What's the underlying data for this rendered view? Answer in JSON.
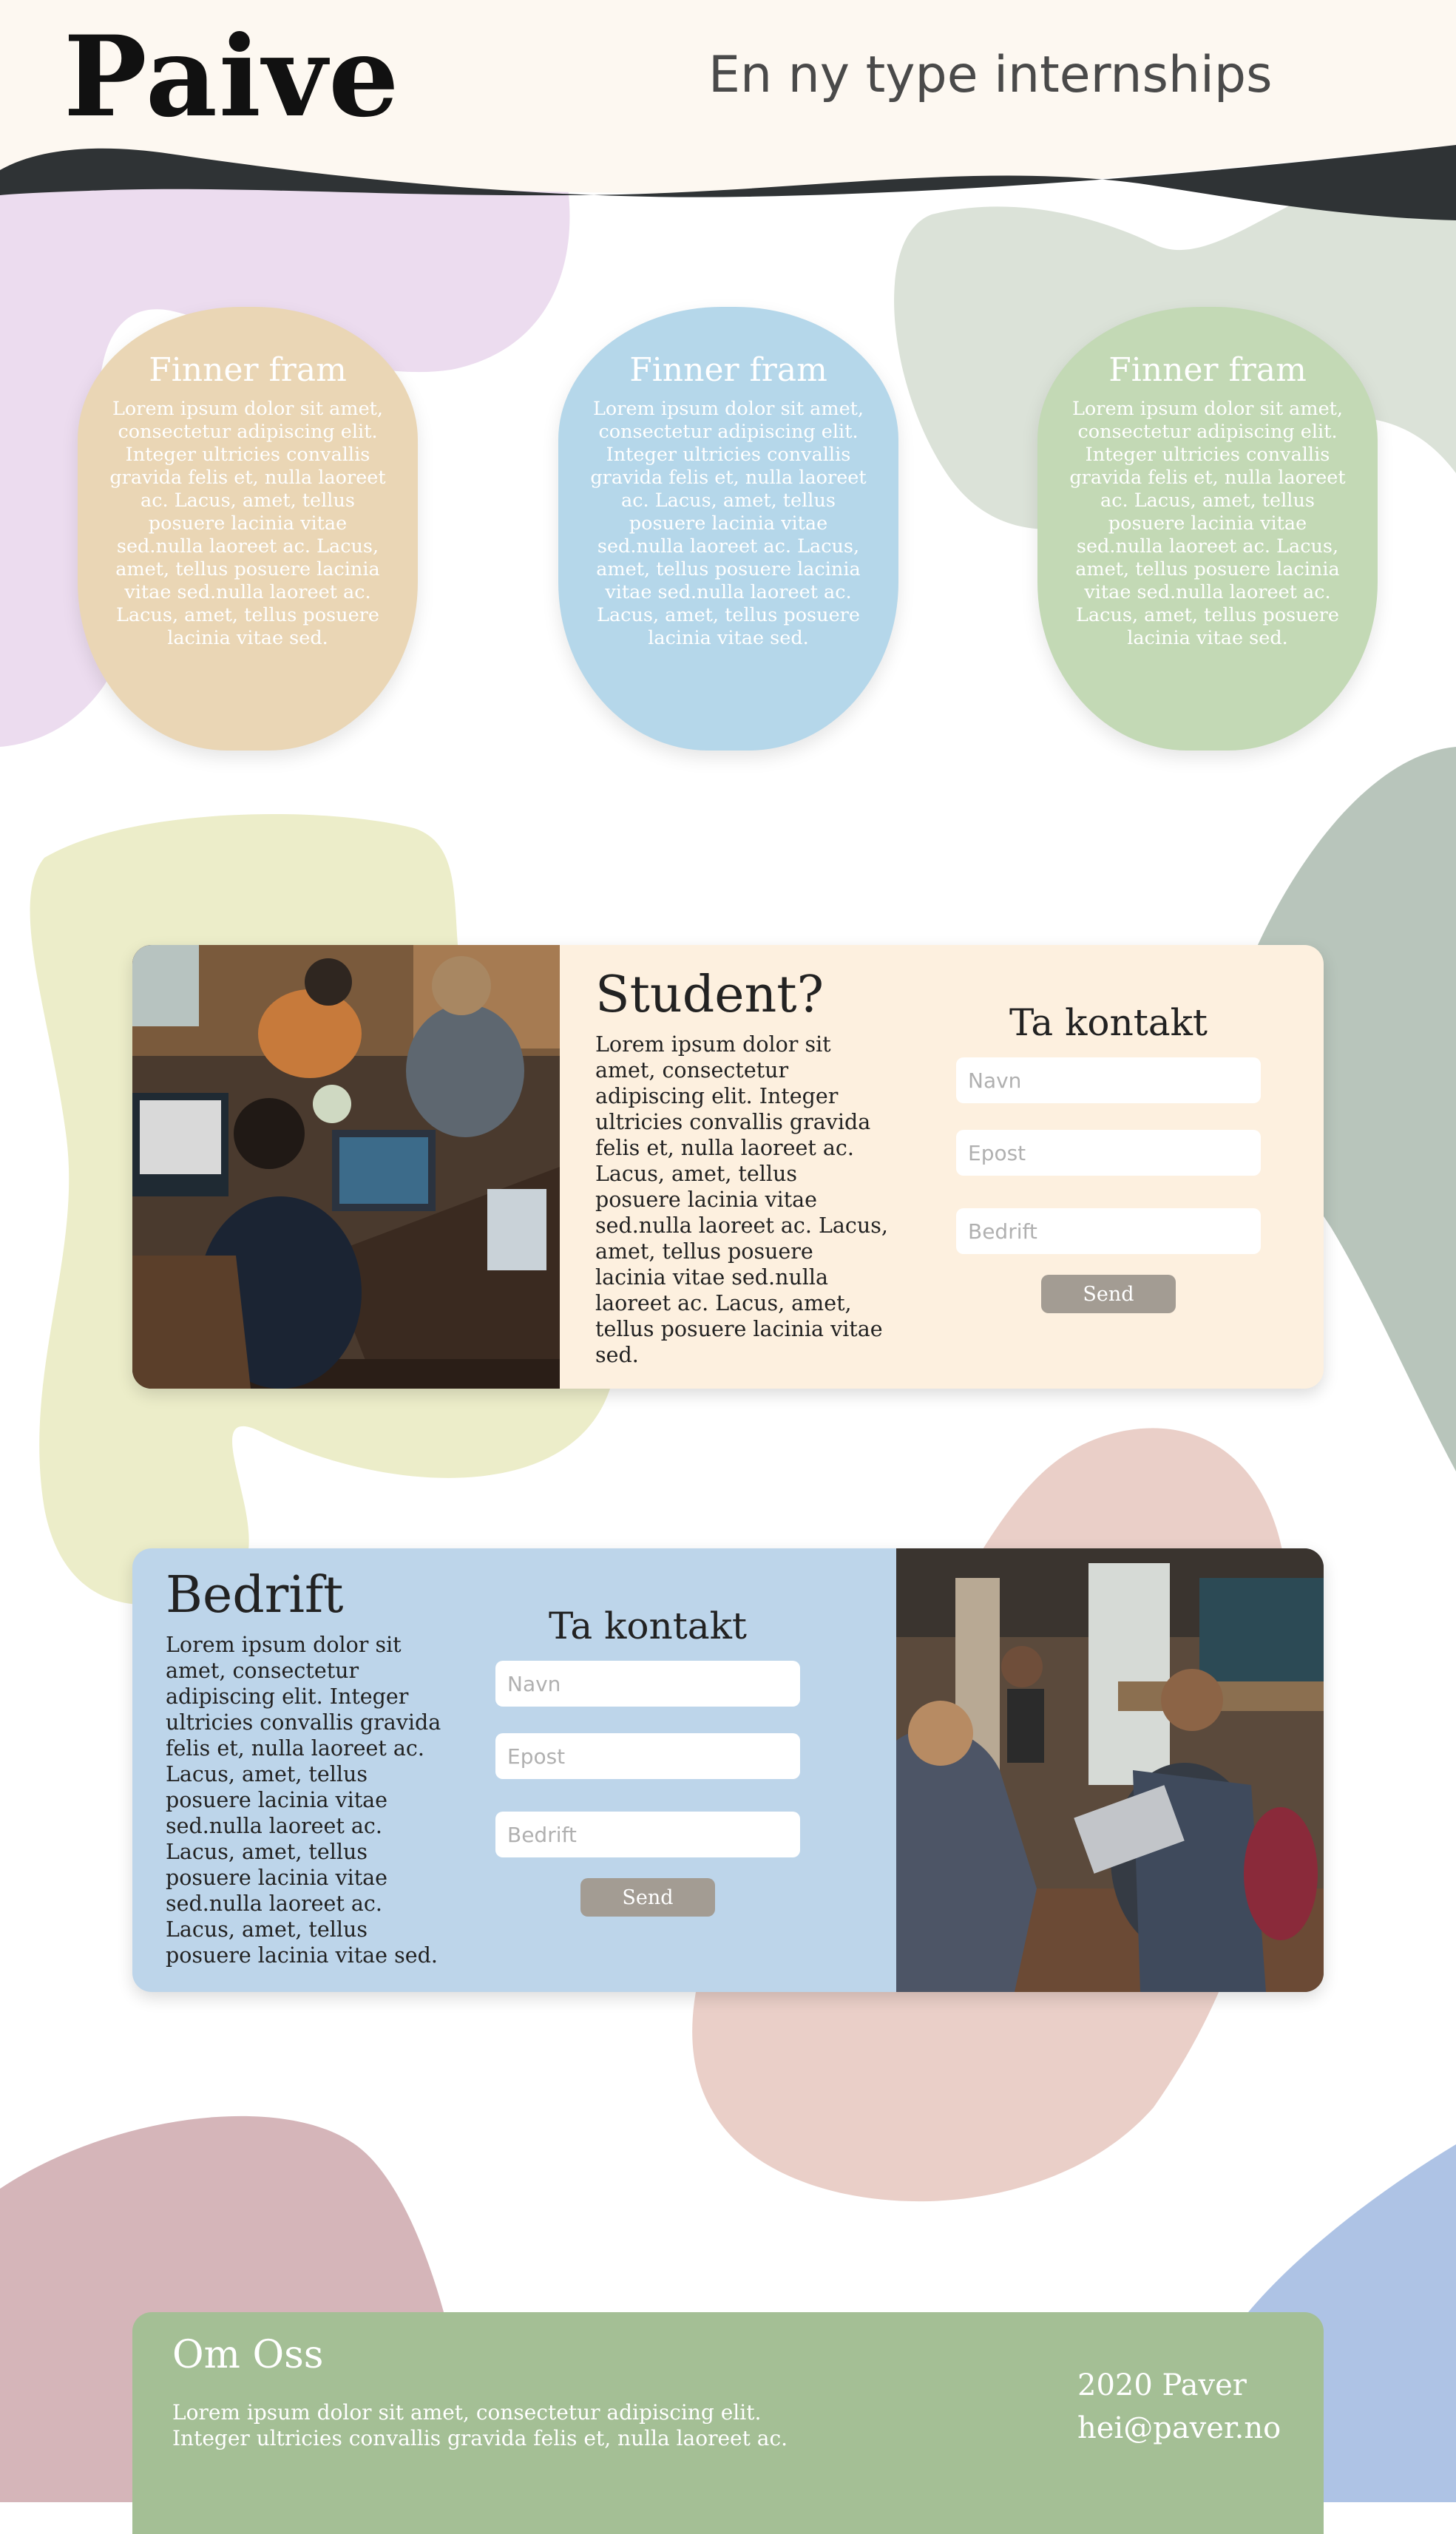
{
  "header": {
    "logo": "Paive",
    "tagline": "En ny type internships"
  },
  "colors": {
    "header_bg": "#fdf8f1",
    "wave": "#2f3335",
    "card_tan": "#ead6b5",
    "card_blue": "#b5d7ea",
    "card_green": "#c3d9b5",
    "student_panel_bg": "#fdf0df",
    "company_panel_bg": "#bdd5ea",
    "footer_bg": "#a4bf95",
    "send_button": "#a39c93"
  },
  "info_cards": [
    {
      "title": "Finner fram",
      "text": "Lorem ipsum dolor sit amet, consectetur adipiscing elit. Integer ultricies convallis gravida felis et, nulla laoreet ac. Lacus, amet, tellus posuere lacinia vitae sed.nulla laoreet ac. Lacus, amet, tellus posuere lacinia vitae sed.nulla laoreet ac. Lacus, amet, tellus posuere lacinia vitae sed."
    },
    {
      "title": "Finner fram",
      "text": "Lorem ipsum dolor sit amet, consectetur adipiscing elit. Integer ultricies convallis gravida felis et, nulla laoreet ac. Lacus, amet, tellus posuere lacinia vitae sed.nulla laoreet ac. Lacus, amet, tellus posuere lacinia vitae sed.nulla laoreet ac. Lacus, amet, tellus posuere lacinia vitae sed."
    },
    {
      "title": "Finner fram",
      "text": "Lorem ipsum dolor sit amet, consectetur adipiscing elit. Integer ultricies convallis gravida felis et, nulla laoreet ac. Lacus, amet, tellus posuere lacinia vitae sed.nulla laoreet ac. Lacus, amet, tellus posuere lacinia vitae sed.nulla laoreet ac. Lacus, amet, tellus posuere lacinia vitae sed."
    }
  ],
  "student": {
    "heading": "Student?",
    "text": "Lorem ipsum dolor sit amet, consectetur adipiscing elit. Integer ultricies convallis gravida felis et, nulla laoreet ac. Lacus, amet, tellus posuere lacinia vitae sed.nulla laoreet ac. Lacus, amet, tellus posuere lacinia vitae sed.nulla laoreet ac. Lacus, amet, tellus posuere lacinia vitae sed.",
    "contact_title": "Ta kontakt",
    "name_placeholder": "Navn",
    "email_placeholder": "Epost",
    "company_placeholder": "Bedrift",
    "send_label": "Send"
  },
  "company": {
    "heading": "Bedrift",
    "text": "Lorem ipsum dolor sit amet, consectetur adipiscing elit. Integer ultricies convallis gravida felis et, nulla laoreet ac. Lacus, amet, tellus posuere lacinia vitae sed.nulla laoreet ac. Lacus, amet, tellus posuere lacinia vitae sed.nulla laoreet ac. Lacus, amet, tellus posuere lacinia vitae sed.",
    "contact_title": "Ta kontakt",
    "name_placeholder": "Navn",
    "email_placeholder": "Epost",
    "company_placeholder": "Bedrift",
    "send_label": "Send"
  },
  "footer": {
    "heading": "Om Oss",
    "text": "Lorem ipsum dolor sit amet, consectetur adipiscing elit. Integer ultricies convallis gravida felis et, nulla laoreet ac.",
    "year": "2020 Paver",
    "email": "hei@paver.no"
  }
}
